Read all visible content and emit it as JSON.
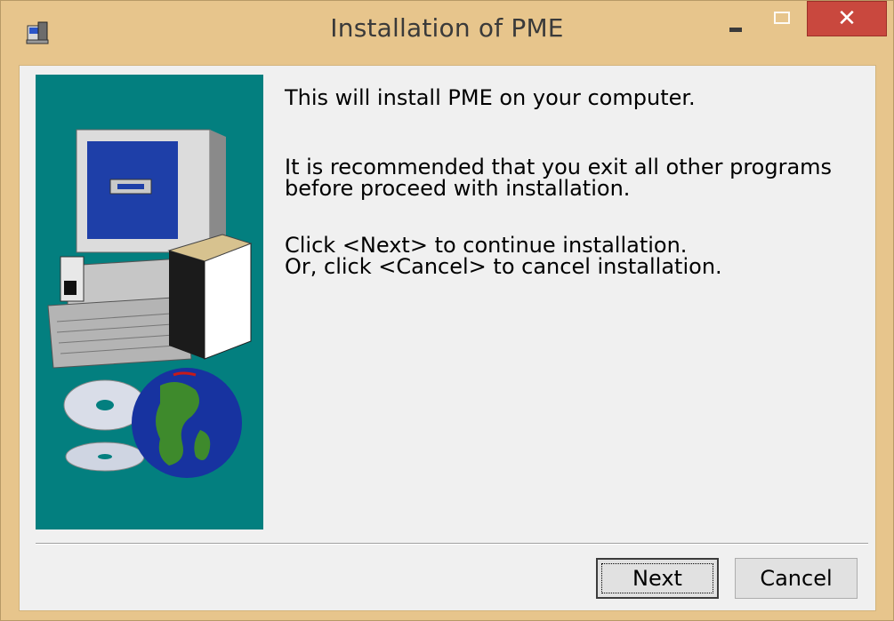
{
  "window": {
    "title": "Installation of PME",
    "controls": {
      "minimize": "minimize-icon",
      "maximize": "maximize-icon",
      "close": "close-icon"
    }
  },
  "messages": {
    "line1": "This will install PME on your computer.",
    "line2": "It is recommended that you exit all other programs",
    "line3": "before proceed with installation.",
    "line4": "Click <Next> to continue installation.",
    "line5": "Or, click <Cancel> to cancel installation."
  },
  "buttons": {
    "next": "Next",
    "cancel": "Cancel"
  },
  "colors": {
    "accent_panel": "#037f7f",
    "close": "#c9483e",
    "frame": "#e7c58c"
  }
}
